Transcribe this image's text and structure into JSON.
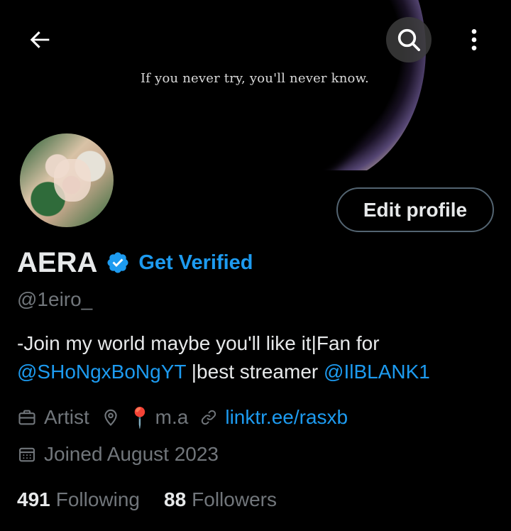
{
  "banner": {
    "tagline": "If you never try, you'll never know."
  },
  "profile": {
    "display_name": "AERA",
    "get_verified_label": "Get Verified",
    "handle": "@1eiro_",
    "edit_profile_label": "Edit profile"
  },
  "bio": {
    "line1": "-Join my world maybe you'll like it|Fan for",
    "mention1": "@SHoNgxBoNgYT",
    "middle": " |best streamer ",
    "mention2": "@IlBLANK1"
  },
  "meta": {
    "profession": "Artist",
    "location_emoji": "📍",
    "location": "m.a",
    "website": "linktr.ee/rasxb",
    "joined": "Joined August 2023"
  },
  "stats": {
    "following_count": "491",
    "following_label": "Following",
    "followers_count": "88",
    "followers_label": "Followers"
  },
  "colors": {
    "accent": "#1d9bf0",
    "secondary_text": "#71767b",
    "primary_text": "#e7e9ea",
    "background": "#000000"
  },
  "icons": [
    "back-arrow-icon",
    "search-icon",
    "more-vertical-icon",
    "verified-badge-icon",
    "briefcase-icon",
    "location-icon",
    "link-icon",
    "calendar-icon"
  ]
}
